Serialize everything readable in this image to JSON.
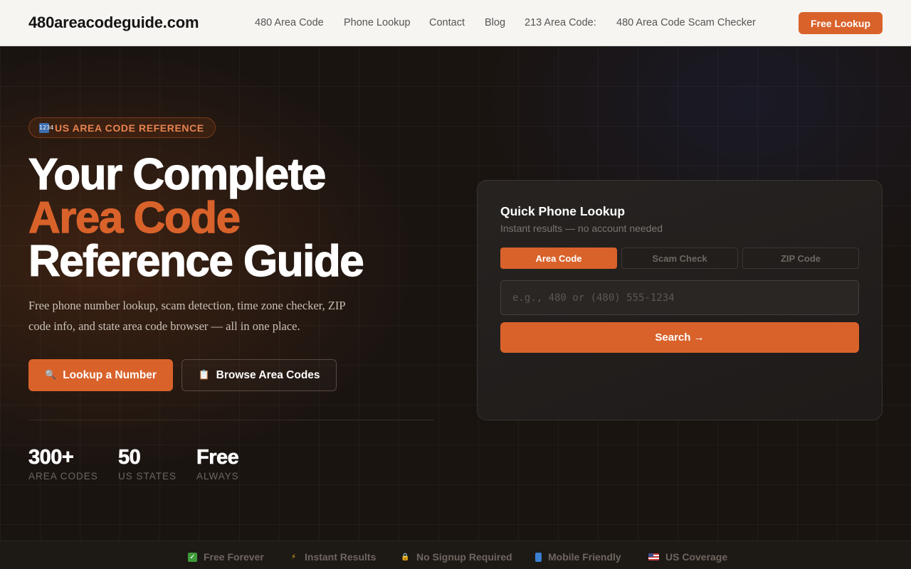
{
  "header": {
    "logo": "480areacodeguide.com",
    "nav": [
      "480 Area Code",
      "Phone Lookup",
      "Contact",
      "Blog",
      "213 Area Code:",
      "480 Area Code Scam Checker"
    ],
    "cta": "Free Lookup"
  },
  "hero": {
    "badge_icon": "numbers-icon",
    "badge": "US AREA CODE REFERENCE",
    "title_line1": "Your Complete",
    "title_line2": "Area Code",
    "title_line3": "Reference Guide",
    "lead": "Free phone number lookup, scam detection, time zone checker, ZIP code info, and state area code browser — all in one place.",
    "primary_button": "Lookup a Number",
    "primary_button_icon": "magnifier-icon",
    "secondary_button": "Browse Area Codes",
    "secondary_button_icon": "clipboard-icon",
    "stats": [
      {
        "value": "300+",
        "label": "AREA CODES"
      },
      {
        "value": "50",
        "label": "US STATES"
      },
      {
        "value": "Free",
        "label": "ALWAYS"
      }
    ]
  },
  "lookup": {
    "title": "Quick Phone Lookup",
    "subtitle": "Instant results — no account needed",
    "tabs": [
      "Area Code",
      "Scam Check",
      "ZIP Code"
    ],
    "active_tab": "Area Code",
    "input_placeholder": "e.g., 480 or (480) 555-1234",
    "input_value": "",
    "search_button": "Search →"
  },
  "features": [
    {
      "icon": "check-icon",
      "label": "Free Forever"
    },
    {
      "icon": "lightning-icon",
      "label": "Instant Results"
    },
    {
      "icon": "lock-icon",
      "label": "No Signup Required"
    },
    {
      "icon": "mobile-icon",
      "label": "Mobile Friendly"
    },
    {
      "icon": "us-flag-icon",
      "label": "US Coverage"
    }
  ],
  "colors": {
    "accent": "#d9622b",
    "header_bg": "#f6f5f1",
    "hero_bg": "#1a1411"
  }
}
